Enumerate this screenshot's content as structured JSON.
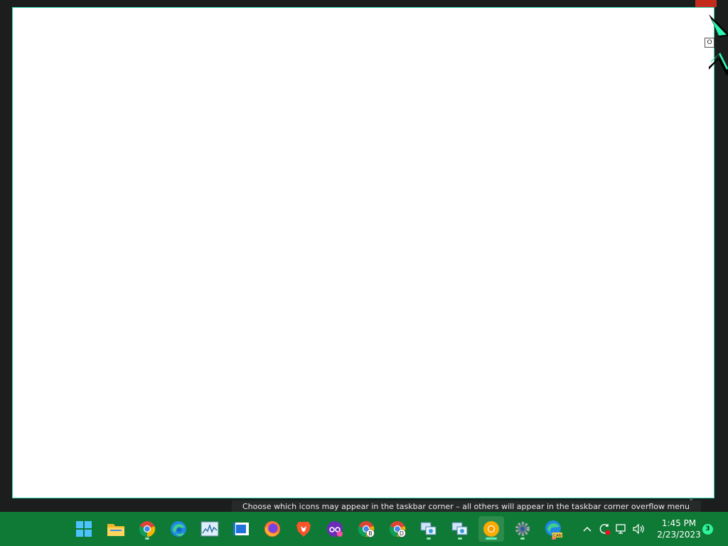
{
  "desktop": {
    "accent_color": "#33d9b2",
    "taskbar_color": "#0f7a35"
  },
  "window": {
    "corner_button_label": "O"
  },
  "tooltip": {
    "text": "Choose which icons may appear in the taskbar corner – all others will appear in the taskbar corner overflow menu"
  },
  "taskbar": {
    "apps": [
      {
        "name": "start",
        "icon": "windows-logo-icon"
      },
      {
        "name": "file-explorer",
        "icon": "folder-icon"
      },
      {
        "name": "chrome",
        "icon": "chrome-icon"
      },
      {
        "name": "edge",
        "icon": "edge-icon"
      },
      {
        "name": "resource-monitor",
        "icon": "chart-icon"
      },
      {
        "name": "media-player",
        "icon": "film-icon"
      },
      {
        "name": "firefox",
        "icon": "firefox-icon"
      },
      {
        "name": "brave",
        "icon": "brave-icon"
      },
      {
        "name": "incognito",
        "icon": "incognito-icon"
      },
      {
        "name": "chrome-profile-b",
        "icon": "chrome-icon",
        "badge": "B"
      },
      {
        "name": "chrome-profile-d",
        "icon": "chrome-icon",
        "badge": "D"
      },
      {
        "name": "network-tool-1",
        "icon": "network-icon"
      },
      {
        "name": "network-tool-2",
        "icon": "network-icon"
      },
      {
        "name": "chrome-canary",
        "icon": "chrome-yellow-icon"
      },
      {
        "name": "settings",
        "icon": "gear-icon"
      },
      {
        "name": "edge-canary",
        "icon": "edge-can-icon",
        "badge": "CAN"
      }
    ],
    "tray": {
      "overflow_icon": "chevron-up-icon",
      "icons": [
        "sync-icon",
        "network-icon",
        "volume-icon"
      ]
    },
    "clock": {
      "time": "1:45 PM",
      "date": "2/23/2023"
    },
    "notification_count": "3"
  }
}
